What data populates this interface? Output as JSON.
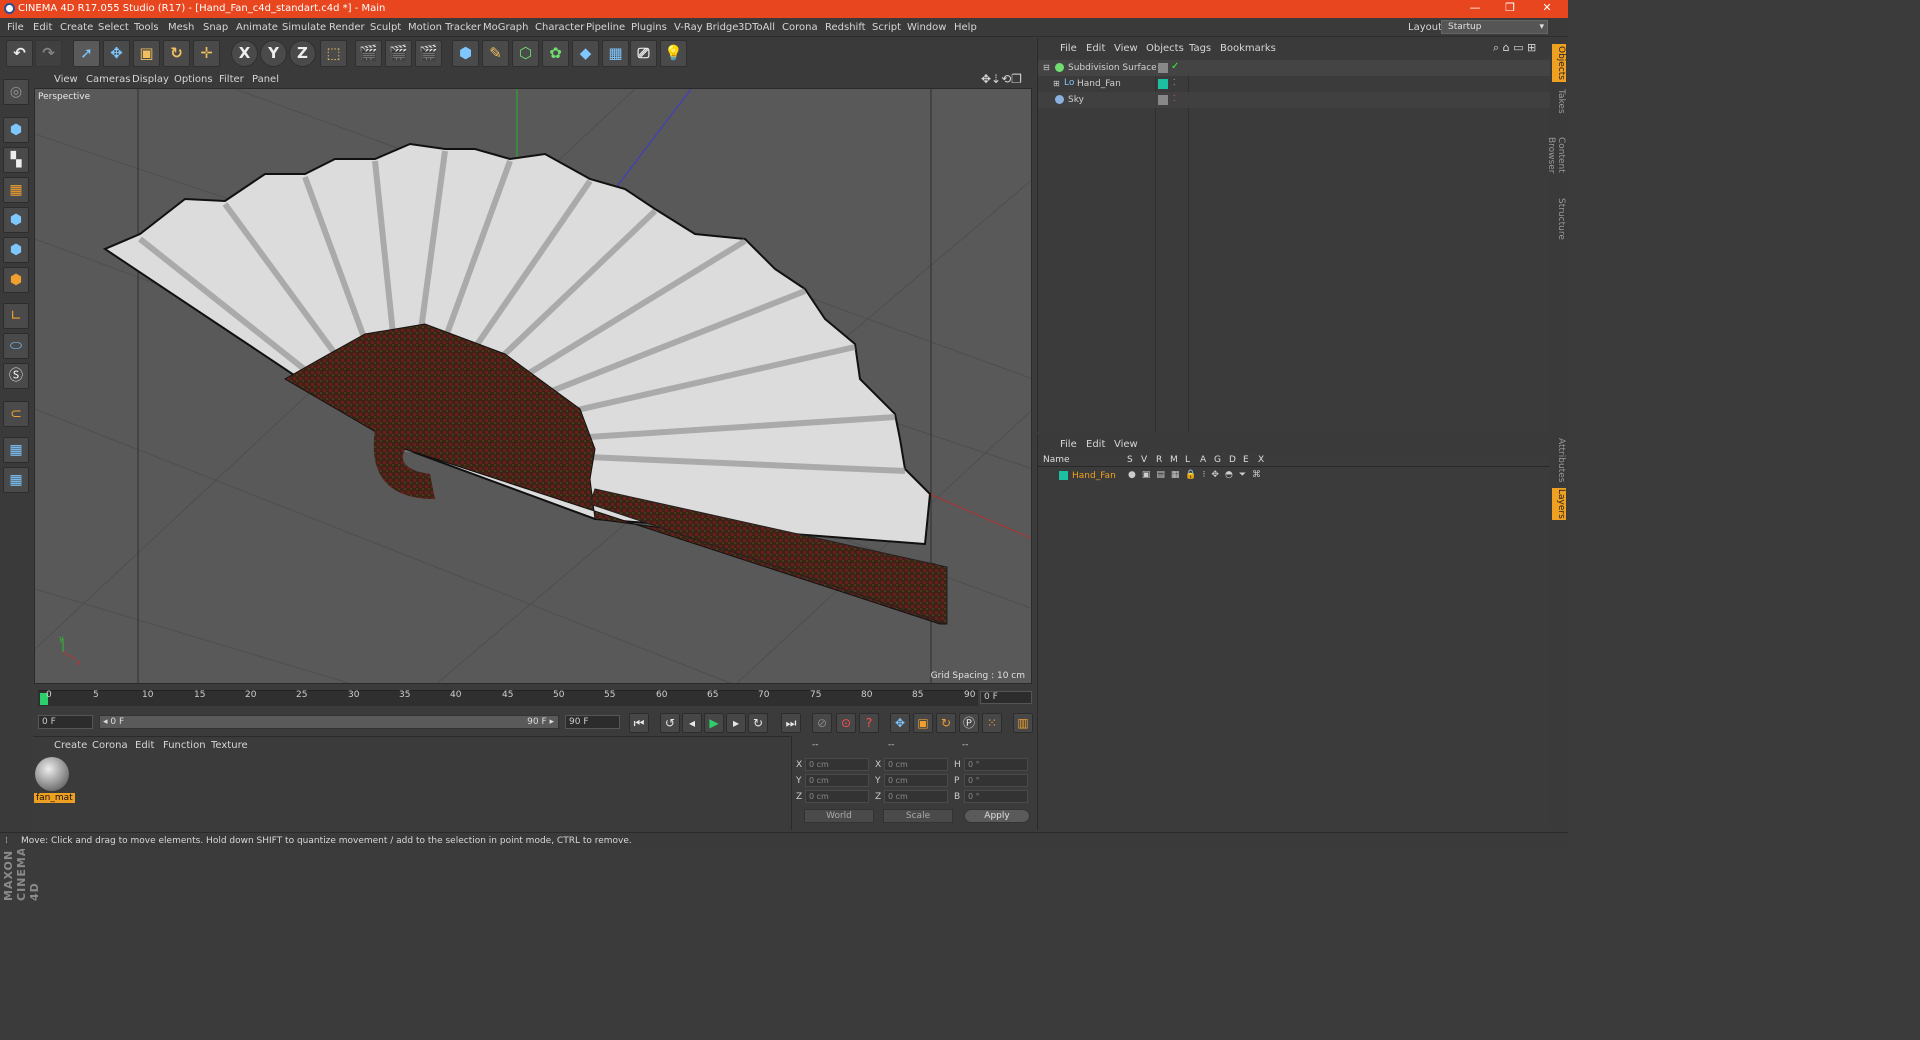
{
  "window": {
    "title": "CINEMA 4D R17.055 Studio (R17) - [Hand_Fan_c4d_standart.c4d *] - Main",
    "minimize": "—",
    "restore": "❐",
    "close": "✕"
  },
  "menu": [
    "File",
    "Edit",
    "Create",
    "Select",
    "Tools",
    "Mesh",
    "Snap",
    "Animate",
    "Simulate",
    "Render",
    "Sculpt",
    "Motion Tracker",
    "MoGraph",
    "Character",
    "Pipeline",
    "Plugins",
    "V-Ray Bridge",
    "3DToAll",
    "Corona",
    "Redshift",
    "Script",
    "Window",
    "Help"
  ],
  "layout": {
    "label": "Layout:",
    "value": "Startup"
  },
  "viewport": {
    "menu": [
      "View",
      "Cameras",
      "Display",
      "Options",
      "Filter",
      "Panel"
    ],
    "label": "Perspective",
    "grid_spacing": "Grid Spacing : 10 cm"
  },
  "timeline": {
    "ticks": [
      "0",
      "5",
      "10",
      "15",
      "20",
      "25",
      "30",
      "35",
      "40",
      "45",
      "50",
      "55",
      "60",
      "65",
      "70",
      "75",
      "80",
      "85",
      "90"
    ],
    "current_frame": "0 F"
  },
  "playback": {
    "start_field": "0 F",
    "range_start": "◂ 0 F",
    "range_end": "90 F ▸",
    "end_field": "90 F"
  },
  "material_manager": {
    "menu": [
      "Create",
      "Corona",
      "Edit",
      "Function",
      "Texture"
    ],
    "material_name": "fan_mat"
  },
  "coordinates": {
    "headers": [
      "--",
      "--",
      "--"
    ],
    "rows": [
      {
        "a": "X",
        "av": "0 cm",
        "b": "X",
        "bv": "0 cm",
        "c": "H",
        "cv": "0 °"
      },
      {
        "a": "Y",
        "av": "0 cm",
        "b": "Y",
        "bv": "0 cm",
        "c": "P",
        "cv": "0 °"
      },
      {
        "a": "Z",
        "av": "0 cm",
        "b": "Z",
        "bv": "0 cm",
        "c": "B",
        "cv": "0 °"
      }
    ],
    "space": "World",
    "mode": "Scale",
    "apply": "Apply"
  },
  "object_manager": {
    "menu": [
      "File",
      "Edit",
      "View",
      "Objects",
      "Tags",
      "Bookmarks"
    ],
    "objects": [
      {
        "name": "Subdivision Surface"
      },
      {
        "name": "Hand_Fan"
      },
      {
        "name": "Sky"
      }
    ]
  },
  "layer_manager": {
    "menu": [
      "File",
      "Edit",
      "View"
    ],
    "columns": [
      "Name",
      "S",
      "V",
      "R",
      "M",
      "L",
      "A",
      "G",
      "D",
      "E",
      "X"
    ],
    "layer_name": "Hand_Fan"
  },
  "right_tabs": [
    "Objects",
    "Takes",
    "Content Browser",
    "Structure",
    "Attributes",
    "Layers"
  ],
  "status": "Move: Click and drag to move elements. Hold down SHIFT to quantize movement / add to the selection in point mode, CTRL to remove.",
  "brand": "MAXON CINEMA 4D",
  "colors": {
    "title_bar": "#e8461e",
    "accent_orange": "#f0a020",
    "layer_teal": "#1cc0a0"
  }
}
